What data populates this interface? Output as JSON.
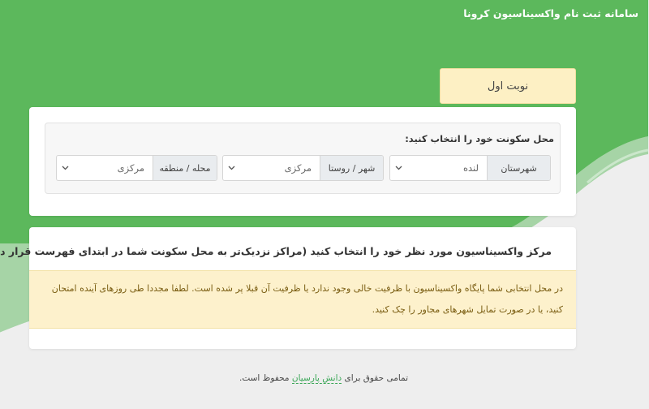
{
  "header": {
    "site_title": "سامانه ثبت نام واکسیناسیون کرونا"
  },
  "turn_tab": {
    "label": "نوبت اول"
  },
  "location": {
    "heading": "محل سکونت خود را انتخاب کنید:",
    "county": {
      "label": "شهرستان",
      "value": "لنده"
    },
    "city": {
      "label": "شهر / روستا",
      "value": "مرکزی"
    },
    "district": {
      "label": "محله / منطقه",
      "value": "مرکزی"
    }
  },
  "center": {
    "heading": "مرکز واکسیناسیون مورد نظر خود را انتخاب کنید (مراکز نزدیک‌تر به محل سکونت شما در ابتدای فهرست قرار دارند)",
    "warning": "در محل انتخابی شما پایگاه واکسیناسیون با ظرفیت خالی وجود ندارد یا ظرفیت آن قبلا پر شده است. لطفا مجددا طی روزهای آینده امتحان کنید، یا در صورت تمایل شهرهای مجاور را چک کنید."
  },
  "footer": {
    "prefix": "تمامی حقوق برای",
    "link": "دانش پارسیان",
    "suffix": "محفوظ است."
  },
  "colors": {
    "brand_green": "#5cb85c",
    "turn_tab_bg": "#fdf0c4",
    "warning_bg": "#fdf1cc",
    "page_bg": "#eeeeee"
  }
}
